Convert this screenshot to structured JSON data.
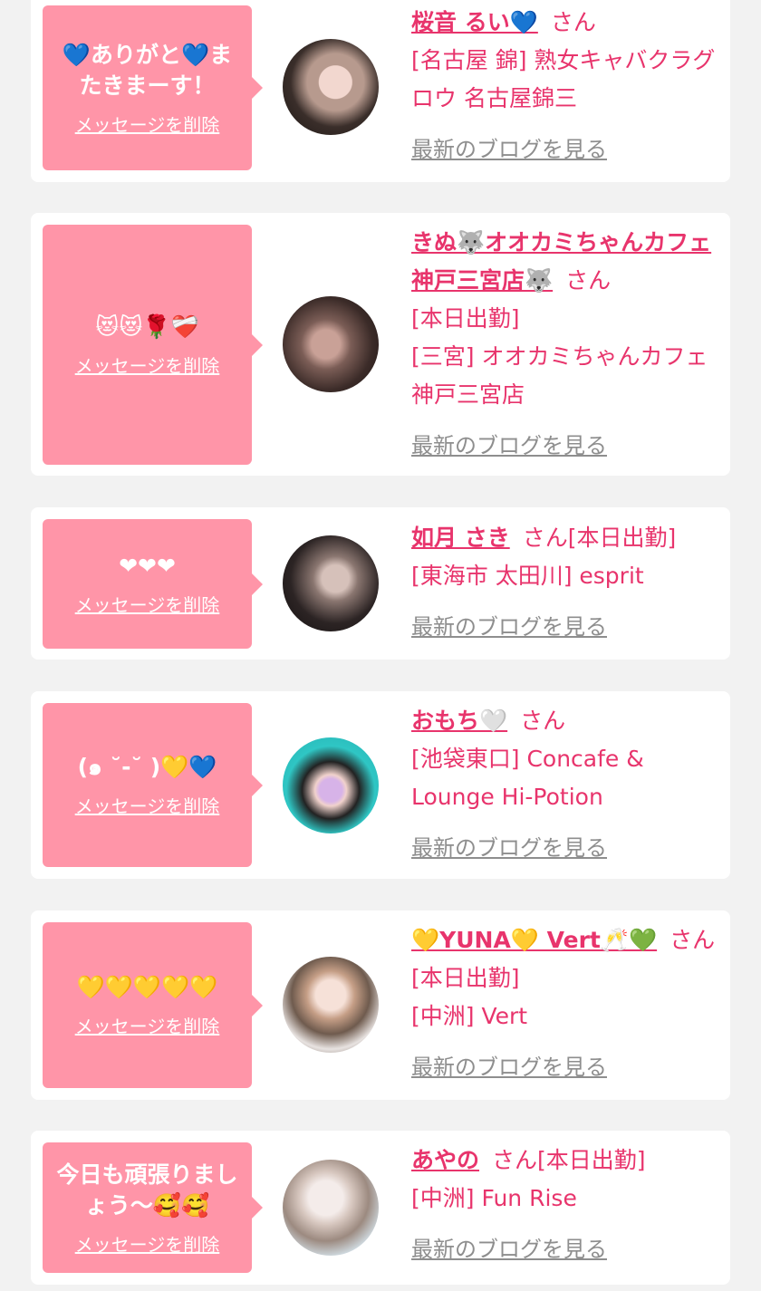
{
  "entries": [
    {
      "message": "💙ありがと💙またきまーす！",
      "delete_label": "メッセージを削除",
      "name": "桜音 るい💙",
      "suffix": "さん",
      "status": "",
      "shop": "[名古屋 錦] 熟女キャバクラグロウ 名古屋錦三",
      "blog_link": "最新のブログを見る"
    },
    {
      "message": "😻😻🌹❤️‍🩹",
      "delete_label": "メッセージを削除",
      "name": "きぬ🐺オオカミちゃんカフェ神戸三宮店🐺",
      "suffix": "さん",
      "status": "[本日出勤]",
      "shop": "[三宮] オオカミちゃんカフェ神戸三宮店",
      "blog_link": "最新のブログを見る"
    },
    {
      "message": "❤❤❤",
      "delete_label": "メッセージを削除",
      "name": "如月 さき",
      "suffix": "さん",
      "status": "[本日出勤]",
      "shop": "[東海市 太田川] esprit",
      "blog_link": "最新のブログを見る"
    },
    {
      "message": "(๑ ˘-˘ )💛💙",
      "delete_label": "メッセージを削除",
      "name": "おもち🤍",
      "suffix": "さん",
      "status": "",
      "shop": "[池袋東口] Concafe & Lounge Hi-Potion",
      "blog_link": "最新のブログを見る"
    },
    {
      "message": "💛💛💛💛💛",
      "delete_label": "メッセージを削除",
      "name": "💛YUNA💛 Vert🥂💚",
      "suffix": "さん",
      "status": "[本日出勤]",
      "shop": "[中洲] Vert",
      "blog_link": "最新のブログを見る"
    },
    {
      "message": "今日も頑張りましょう〜🥰🥰",
      "delete_label": "メッセージを削除",
      "name": "あやの",
      "suffix": "さん",
      "status": "[本日出勤]",
      "shop": "[中洲] Fun Rise",
      "blog_link": "最新のブログを見る"
    }
  ]
}
